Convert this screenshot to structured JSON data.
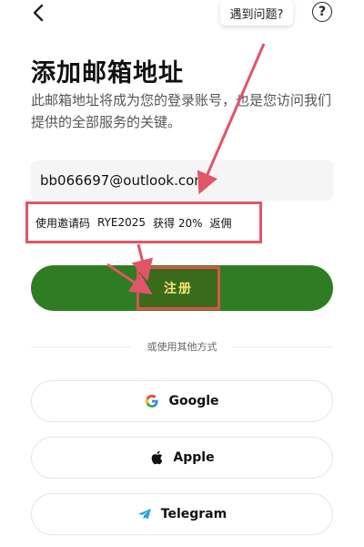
{
  "header": {
    "back_icon": "chevron-left-icon",
    "help_bubble_text": "遇到问题?",
    "help_icon_glyph": "?"
  },
  "page": {
    "title": "添加邮箱地址",
    "subtitle": "此邮箱地址将成为您的登录账号，也是您访问我们提供的全部服务的关键。"
  },
  "email_field": {
    "value": "bb066697@outlook.com"
  },
  "invite": {
    "prefix": "使用邀请码",
    "code": "RYE2025",
    "middle": "获得 20%",
    "suffix": "返佣"
  },
  "register": {
    "label": "注册"
  },
  "divider": {
    "text": "或使用其他方式"
  },
  "social": {
    "google_label": "Google",
    "apple_label": "Apple",
    "telegram_label": "Telegram"
  },
  "colors": {
    "accent_green": "#2e7d22",
    "annotation_red": "#e15569",
    "register_text": "#f6e27a"
  }
}
